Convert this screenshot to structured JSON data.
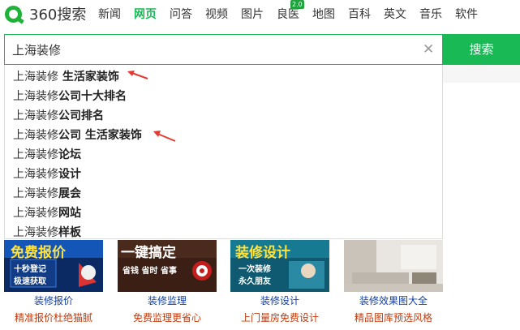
{
  "logo": {
    "text": "360搜索"
  },
  "nav": [
    {
      "label": "新闻"
    },
    {
      "label": "网页",
      "active": true
    },
    {
      "label": "问答"
    },
    {
      "label": "视频"
    },
    {
      "label": "图片"
    },
    {
      "label": "良医",
      "badge": "2.0"
    },
    {
      "label": "地图"
    },
    {
      "label": "百科"
    },
    {
      "label": "英文"
    },
    {
      "label": "音乐"
    },
    {
      "label": "软件"
    }
  ],
  "search": {
    "value": "上海装修",
    "button_label": "搜索",
    "clear_icon": "close-icon"
  },
  "suggestions": [
    {
      "prefix": "上海装修",
      "bold": " 生活家装饰",
      "arrow": true
    },
    {
      "prefix": "上海装修",
      "bold": "公司十大排名"
    },
    {
      "prefix": "上海装修",
      "bold": "公司排名"
    },
    {
      "prefix": "上海装修",
      "bold": "公司 生活家装饰",
      "arrow": true
    },
    {
      "prefix": "上海装修",
      "bold": "论坛"
    },
    {
      "prefix": "上海装修",
      "bold": "设计"
    },
    {
      "prefix": "上海装修",
      "bold": "展会"
    },
    {
      "prefix": "上海装修",
      "bold": "网站"
    },
    {
      "prefix": "上海装修",
      "bold": "样板"
    }
  ],
  "thumbs": [
    {
      "banner": "免费报价",
      "sub1": "十秒登记",
      "sub2": "极速获取",
      "caption": "装修报价",
      "desc": "精准报价杜绝猫腻"
    },
    {
      "banner": "一键搞定",
      "sub1": "省钱 省时 省事",
      "caption": "装修监理",
      "desc": "免费监理更省心"
    },
    {
      "banner": "装修设计",
      "sub1": "一次装修",
      "sub2": "永久朋友",
      "caption": "装修设计",
      "desc": "上门量房免费设计"
    },
    {
      "caption": "装修效果图大全",
      "desc": "精品图库预选风格"
    }
  ],
  "colors": {
    "brand": "#19b955",
    "arrow": "#e23a33",
    "link": "#0f3ea6",
    "desc": "#c43b0d"
  }
}
